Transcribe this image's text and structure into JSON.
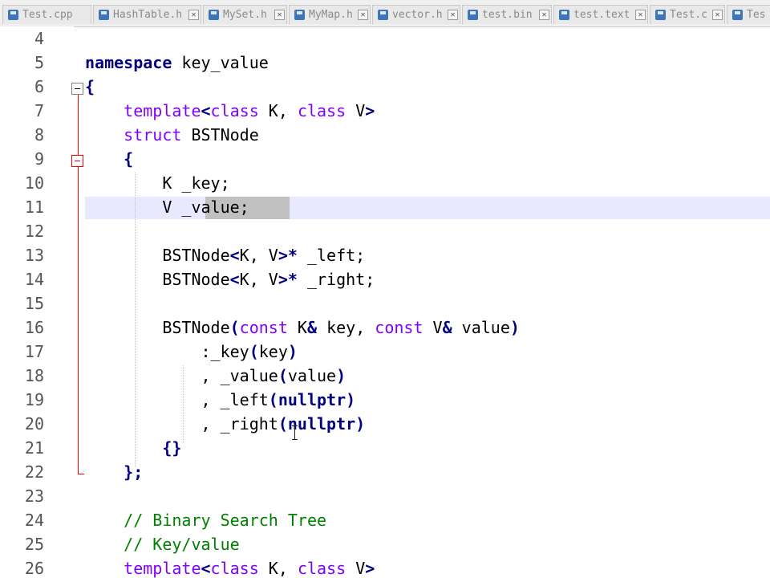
{
  "tabs": [
    {
      "label": "Test.cpp"
    },
    {
      "label": "HashTable.h"
    },
    {
      "label": "MySet.h"
    },
    {
      "label": "MyMap.h"
    },
    {
      "label": "vector.h"
    },
    {
      "label": "test.bin"
    },
    {
      "label": "test.text"
    },
    {
      "label": "Test.c"
    },
    {
      "label": "Tes"
    }
  ],
  "line_numbers": [
    "4",
    "5",
    "6",
    "7",
    "8",
    "9",
    "10",
    "11",
    "12",
    "13",
    "14",
    "15",
    "16",
    "17",
    "18",
    "19",
    "20",
    "21",
    "22",
    "23",
    "24",
    "25",
    "26"
  ],
  "code": [
    [],
    [
      {
        "t": "kw",
        "v": "namespace"
      },
      {
        "t": "",
        "v": " key_value"
      }
    ],
    [
      {
        "t": "op",
        "v": "{"
      }
    ],
    [
      {
        "t": "",
        "v": "    "
      },
      {
        "t": "kt",
        "v": "template"
      },
      {
        "t": "op",
        "v": "<"
      },
      {
        "t": "kt",
        "v": "class"
      },
      {
        "t": "",
        "v": " K, "
      },
      {
        "t": "kt",
        "v": "class"
      },
      {
        "t": "",
        "v": " V"
      },
      {
        "t": "op",
        "v": ">"
      }
    ],
    [
      {
        "t": "",
        "v": "    "
      },
      {
        "t": "kt",
        "v": "struct"
      },
      {
        "t": "",
        "v": " BSTNode"
      }
    ],
    [
      {
        "t": "",
        "v": "    "
      },
      {
        "t": "op",
        "v": "{"
      }
    ],
    [
      {
        "t": "",
        "v": "        K _key;"
      }
    ],
    [
      {
        "t": "",
        "v": "        V _value;"
      }
    ],
    [],
    [
      {
        "t": "",
        "v": "        BSTNode"
      },
      {
        "t": "op",
        "v": "<"
      },
      {
        "t": "",
        "v": "K, V"
      },
      {
        "t": "op",
        "v": ">*"
      },
      {
        "t": "",
        "v": " _left;"
      }
    ],
    [
      {
        "t": "",
        "v": "        BSTNode"
      },
      {
        "t": "op",
        "v": "<"
      },
      {
        "t": "",
        "v": "K, V"
      },
      {
        "t": "op",
        "v": ">*"
      },
      {
        "t": "",
        "v": " _right;"
      }
    ],
    [],
    [
      {
        "t": "",
        "v": "        BSTNode"
      },
      {
        "t": "op",
        "v": "("
      },
      {
        "t": "kt",
        "v": "const"
      },
      {
        "t": "",
        "v": " K"
      },
      {
        "t": "op",
        "v": "&"
      },
      {
        "t": "",
        "v": " key, "
      },
      {
        "t": "kt",
        "v": "const"
      },
      {
        "t": "",
        "v": " V"
      },
      {
        "t": "op",
        "v": "&"
      },
      {
        "t": "",
        "v": " value"
      },
      {
        "t": "op",
        "v": ")"
      }
    ],
    [
      {
        "t": "",
        "v": "            :_key"
      },
      {
        "t": "op",
        "v": "("
      },
      {
        "t": "",
        "v": "key"
      },
      {
        "t": "op",
        "v": ")"
      }
    ],
    [
      {
        "t": "",
        "v": "            , _value"
      },
      {
        "t": "op",
        "v": "("
      },
      {
        "t": "",
        "v": "value"
      },
      {
        "t": "op",
        "v": ")"
      }
    ],
    [
      {
        "t": "",
        "v": "            , _left"
      },
      {
        "t": "op",
        "v": "("
      },
      {
        "t": "kw",
        "v": "nullptr"
      },
      {
        "t": "op",
        "v": ")"
      }
    ],
    [
      {
        "t": "",
        "v": "            , _right"
      },
      {
        "t": "op",
        "v": "("
      },
      {
        "t": "kw",
        "v": "nullptr"
      },
      {
        "t": "op",
        "v": ")"
      }
    ],
    [
      {
        "t": "",
        "v": "        "
      },
      {
        "t": "op",
        "v": "{}"
      }
    ],
    [
      {
        "t": "",
        "v": "    "
      },
      {
        "t": "op",
        "v": "};"
      }
    ],
    [],
    [
      {
        "t": "",
        "v": "    "
      },
      {
        "t": "cm",
        "v": "// Binary Search Tree"
      }
    ],
    [
      {
        "t": "",
        "v": "    "
      },
      {
        "t": "cm",
        "v": "// Key/value"
      }
    ],
    [
      {
        "t": "",
        "v": "    "
      },
      {
        "t": "kt",
        "v": "template"
      },
      {
        "t": "op",
        "v": "<"
      },
      {
        "t": "kt",
        "v": "class"
      },
      {
        "t": "",
        "v": " K, "
      },
      {
        "t": "kt",
        "v": "class"
      },
      {
        "t": "",
        "v": " V"
      },
      {
        "t": "op",
        "v": ">"
      }
    ]
  ],
  "colors": {
    "keyword": "#000080",
    "type_keyword": "#8000ff",
    "comment": "#008000",
    "current_line": "#e8e8ff",
    "selection": "#c0c0c0",
    "fold_marker": "#ff0000"
  },
  "icons": {
    "tab_file": "save-disk-icon",
    "tab_close": "close-icon",
    "fold_open": "fold-minus-icon",
    "text_cursor": "ibeam-cursor-icon"
  }
}
